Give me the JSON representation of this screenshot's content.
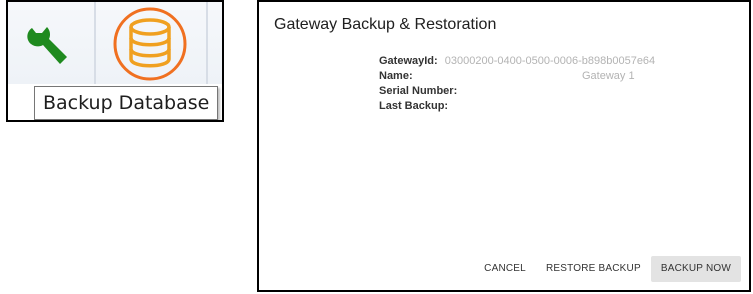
{
  "toolbar": {
    "tools": [
      {
        "icon": "wrench-icon",
        "color": "#1f8a1f"
      },
      {
        "icon": "database-icon",
        "color": "#f0a020",
        "highlight_color": "#f07020"
      }
    ],
    "tooltip": "Backup Database"
  },
  "dialog": {
    "title": "Gateway Backup & Restoration",
    "fields": {
      "gateway_id_label": "GatewayId:",
      "gateway_id_value": "03000200-0400-0500-0006-b898b0057e64",
      "name_label": "Name:",
      "name_value": "Gateway 1",
      "serial_label": "Serial Number:",
      "serial_value": "",
      "last_backup_label": "Last Backup:",
      "last_backup_value": ""
    },
    "buttons": {
      "cancel": "CANCEL",
      "restore": "RESTORE BACKUP",
      "backup_now": "BACKUP NOW"
    }
  }
}
